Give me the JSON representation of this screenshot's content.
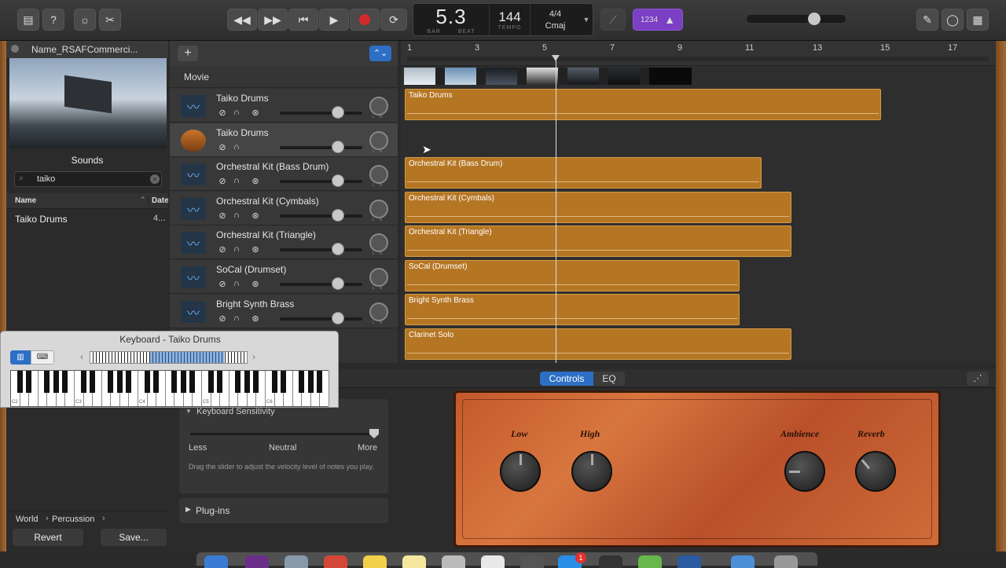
{
  "lcd": {
    "beat": "5.3",
    "bar_label": "BAR",
    "beat_label": "BEAT",
    "tempo": "144",
    "tempo_label": "TEMPO",
    "signature": "4/4",
    "key": "Cmaj"
  },
  "toolbar": {
    "count_in": "1234"
  },
  "library": {
    "project_name": "Name_RSAFCommerci...",
    "sounds_title": "Sounds",
    "search_value": "taiko",
    "col_name": "Name",
    "col_date": "Date",
    "result_name": "Taiko Drums",
    "result_date": "4...",
    "breadcrumb_1": "World",
    "breadcrumb_2": "Percussion",
    "revert": "Revert",
    "save": "Save..."
  },
  "movie_label": "Movie",
  "tracks": [
    {
      "name": "Taiko Drums"
    },
    {
      "name": "Taiko Drums"
    },
    {
      "name": "Orchestral Kit (Bass Drum)"
    },
    {
      "name": "Orchestral Kit (Cymbals)"
    },
    {
      "name": "Orchestral Kit (Triangle)"
    },
    {
      "name": "SoCal (Drumset)"
    },
    {
      "name": "Bright Synth Brass"
    }
  ],
  "regions": [
    {
      "name": "Taiko Drums"
    },
    {
      "name": "Orchestral Kit (Bass Drum)"
    },
    {
      "name": "Orchestral Kit (Cymbals)"
    },
    {
      "name": "Orchestral Kit (Triangle)"
    },
    {
      "name": "SoCal (Drumset)"
    },
    {
      "name": "Bright Synth Brass"
    },
    {
      "name": "Clarinet Solo"
    }
  ],
  "ruler": [
    "1",
    "3",
    "5",
    "7",
    "9",
    "11",
    "13",
    "15",
    "17"
  ],
  "keyboard": {
    "title": "Keyboard - Taiko Drums",
    "octaves": [
      "C2",
      "C3",
      "C4",
      "C5",
      "C6"
    ]
  },
  "smart_controls": {
    "tab_controls": "Controls",
    "tab_eq": "EQ",
    "sensitivity_title": "Keyboard Sensitivity",
    "less": "Less",
    "neutral": "Neutral",
    "more": "More",
    "help": "Drag the slider to adjust the velocity level of notes you play.",
    "plugins": "Plug-ins",
    "knob_low": "Low",
    "knob_high": "High",
    "knob_ambience": "Ambience",
    "knob_reverb": "Reverb"
  },
  "dock_badge": "1",
  "colors": {
    "region": "#b57624",
    "accent": "#2d6fc4",
    "record": "#d12b2b",
    "tuner": "#7b3fc4"
  }
}
